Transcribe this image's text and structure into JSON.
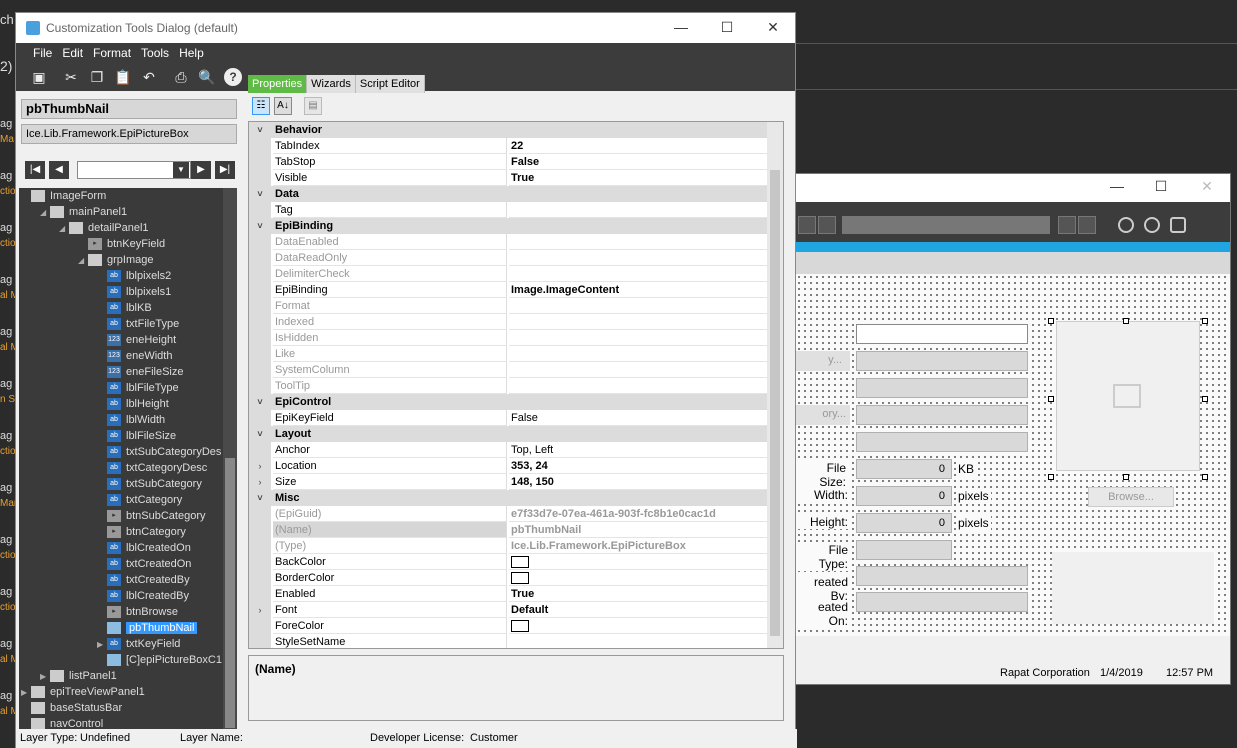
{
  "background": {
    "side_labels": [
      "ag",
      "Ma",
      "ag",
      "ctio",
      "ag",
      "ctio",
      "ag",
      "al M",
      "ag",
      "al M",
      "ag",
      "n Se",
      "ag",
      "ctio",
      "ag",
      "Mar",
      "ag",
      "ctio",
      "ag",
      "ctio",
      "ag",
      "al M",
      "ag",
      "al M"
    ],
    "top_fragment_1": "ch",
    "top_fragment_2": "2)",
    "form": {
      "labels": {
        "file_size": "File Size:",
        "width": "Width:",
        "height": "Height:",
        "file_type": "File Type:",
        "created_by": "reated By:",
        "created_on": "eated On:",
        "kb": "KB",
        "pixels_w": "pixels",
        "pixels_h": "pixels",
        "cat_frag": "y...",
        "subcat_frag": "ory..."
      },
      "values": {
        "file_size": "0",
        "width": "0",
        "height": "0"
      },
      "browse_label": "Browse...",
      "status": {
        "company": "Rapat Corporation",
        "date": "1/4/2019",
        "time": "12:57 PM"
      }
    }
  },
  "dialog": {
    "title": "Customization Tools Dialog (default)",
    "menu": [
      "File",
      "Edit",
      "Format",
      "Tools",
      "Help"
    ],
    "selected_control": "pbThumbNail",
    "selected_type": "Ice.Lib.Framework.EpiPictureBox",
    "tabs": [
      "Properties",
      "Wizards",
      "Script Editor"
    ],
    "tree": [
      {
        "label": "ImageForm",
        "depth": 0,
        "icon": "form",
        "exp": ""
      },
      {
        "label": "mainPanel1",
        "depth": 1,
        "icon": "panel",
        "exp": "◢"
      },
      {
        "label": "detailPanel1",
        "depth": 2,
        "icon": "panel",
        "exp": "◢"
      },
      {
        "label": "btnKeyField",
        "depth": 3,
        "icon": "btn",
        "exp": ""
      },
      {
        "label": "grpImage",
        "depth": 3,
        "icon": "grp",
        "exp": "◢"
      },
      {
        "label": "lblpixels2",
        "depth": 4,
        "icon": "ab",
        "exp": ""
      },
      {
        "label": "lblpixels1",
        "depth": 4,
        "icon": "ab",
        "exp": ""
      },
      {
        "label": "lblKB",
        "depth": 4,
        "icon": "ab",
        "exp": ""
      },
      {
        "label": "txtFileType",
        "depth": 4,
        "icon": "ab",
        "exp": ""
      },
      {
        "label": "eneHeight",
        "depth": 4,
        "icon": "num",
        "exp": ""
      },
      {
        "label": "eneWidth",
        "depth": 4,
        "icon": "num",
        "exp": ""
      },
      {
        "label": "eneFileSize",
        "depth": 4,
        "icon": "num",
        "exp": ""
      },
      {
        "label": "lblFileType",
        "depth": 4,
        "icon": "ab",
        "exp": ""
      },
      {
        "label": "lblHeight",
        "depth": 4,
        "icon": "ab",
        "exp": ""
      },
      {
        "label": "lblWidth",
        "depth": 4,
        "icon": "ab",
        "exp": ""
      },
      {
        "label": "lblFileSize",
        "depth": 4,
        "icon": "ab",
        "exp": ""
      },
      {
        "label": "txtSubCategoryDes",
        "depth": 4,
        "icon": "ab",
        "exp": ""
      },
      {
        "label": "txtCategoryDesc",
        "depth": 4,
        "icon": "ab",
        "exp": ""
      },
      {
        "label": "txtSubCategory",
        "depth": 4,
        "icon": "ab",
        "exp": ""
      },
      {
        "label": "txtCategory",
        "depth": 4,
        "icon": "ab",
        "exp": ""
      },
      {
        "label": "btnSubCategory",
        "depth": 4,
        "icon": "btn",
        "exp": ""
      },
      {
        "label": "btnCategory",
        "depth": 4,
        "icon": "btn",
        "exp": ""
      },
      {
        "label": "lblCreatedOn",
        "depth": 4,
        "icon": "ab",
        "exp": ""
      },
      {
        "label": "txtCreatedOn",
        "depth": 4,
        "icon": "ab",
        "exp": ""
      },
      {
        "label": "txtCreatedBy",
        "depth": 4,
        "icon": "ab",
        "exp": ""
      },
      {
        "label": "lblCreatedBy",
        "depth": 4,
        "icon": "ab",
        "exp": ""
      },
      {
        "label": "btnBrowse",
        "depth": 4,
        "icon": "btn",
        "exp": ""
      },
      {
        "label": "pbThumbNail",
        "depth": 4,
        "icon": "pic",
        "exp": "",
        "selected": true
      },
      {
        "label": "txtKeyField",
        "depth": 4,
        "icon": "ab",
        "exp": "▶"
      },
      {
        "label": "[C]epiPictureBoxC1",
        "depth": 4,
        "icon": "pic",
        "exp": ""
      },
      {
        "label": "listPanel1",
        "depth": 1,
        "icon": "panel",
        "exp": "▶"
      },
      {
        "label": "epiTreeViewPanel1",
        "depth": 0,
        "icon": "tree",
        "exp": "▶"
      },
      {
        "label": "baseStatusBar",
        "depth": 0,
        "icon": "bar",
        "exp": ""
      },
      {
        "label": "navControl",
        "depth": 0,
        "icon": "bar",
        "exp": ""
      }
    ],
    "properties": [
      {
        "kind": "cat",
        "name": "Behavior"
      },
      {
        "name": "TabIndex",
        "value": "22",
        "bold": true
      },
      {
        "name": "TabStop",
        "value": "False",
        "bold": true
      },
      {
        "name": "Visible",
        "value": "True",
        "bold": true
      },
      {
        "kind": "cat",
        "name": "Data"
      },
      {
        "name": "Tag",
        "value": ""
      },
      {
        "kind": "cat",
        "name": "EpiBinding"
      },
      {
        "name": "DataEnabled",
        "value": "",
        "dim": true
      },
      {
        "name": "DataReadOnly",
        "value": "",
        "dim": true
      },
      {
        "name": "DelimiterCheck",
        "value": "",
        "dim": true
      },
      {
        "name": "EpiBinding",
        "value": "Image.ImageContent",
        "bold": true
      },
      {
        "name": "Format",
        "value": "",
        "dim": true
      },
      {
        "name": "Indexed",
        "value": "",
        "dim": true
      },
      {
        "name": "IsHidden",
        "value": "",
        "dim": true
      },
      {
        "name": "Like",
        "value": "",
        "dim": true
      },
      {
        "name": "SystemColumn",
        "value": "",
        "dim": true
      },
      {
        "name": "ToolTip",
        "value": "",
        "dim": true
      },
      {
        "kind": "cat",
        "name": "EpiControl"
      },
      {
        "name": "EpiKeyField",
        "value": "False"
      },
      {
        "kind": "cat",
        "name": "Layout"
      },
      {
        "name": "Anchor",
        "value": "Top, Left"
      },
      {
        "name": "Location",
        "value": "353, 24",
        "bold": true,
        "exp": true
      },
      {
        "name": "Size",
        "value": "148, 150",
        "bold": true,
        "exp": true
      },
      {
        "kind": "cat",
        "name": "Misc"
      },
      {
        "name": "(EpiGuid)",
        "value": "e7f33d7e-07ea-461a-903f-fc8b1e0cac1d",
        "dim": true,
        "bold": true
      },
      {
        "name": "(Name)",
        "value": "pbThumbNail",
        "dim": true,
        "bold": true,
        "selrow": true
      },
      {
        "name": "(Type)",
        "value": "Ice.Lib.Framework.EpiPictureBox",
        "dim": true,
        "bold": true
      },
      {
        "name": "BackColor",
        "value": "",
        "swatch": true
      },
      {
        "name": "BorderColor",
        "value": "",
        "swatch": true
      },
      {
        "name": "Enabled",
        "value": "True",
        "bold": true
      },
      {
        "name": "Font",
        "value": "Default",
        "bold": true,
        "exp": true
      },
      {
        "name": "ForeColor",
        "value": "",
        "swatch": true
      },
      {
        "name": "StyleSetName",
        "value": ""
      }
    ],
    "description": "(Name)",
    "status": {
      "layer_type_label": "Layer Type:",
      "layer_type_value": "Undefined",
      "layer_name_label": "Layer Name:",
      "license_label": "Developer License:",
      "license_value": "Customer"
    }
  }
}
